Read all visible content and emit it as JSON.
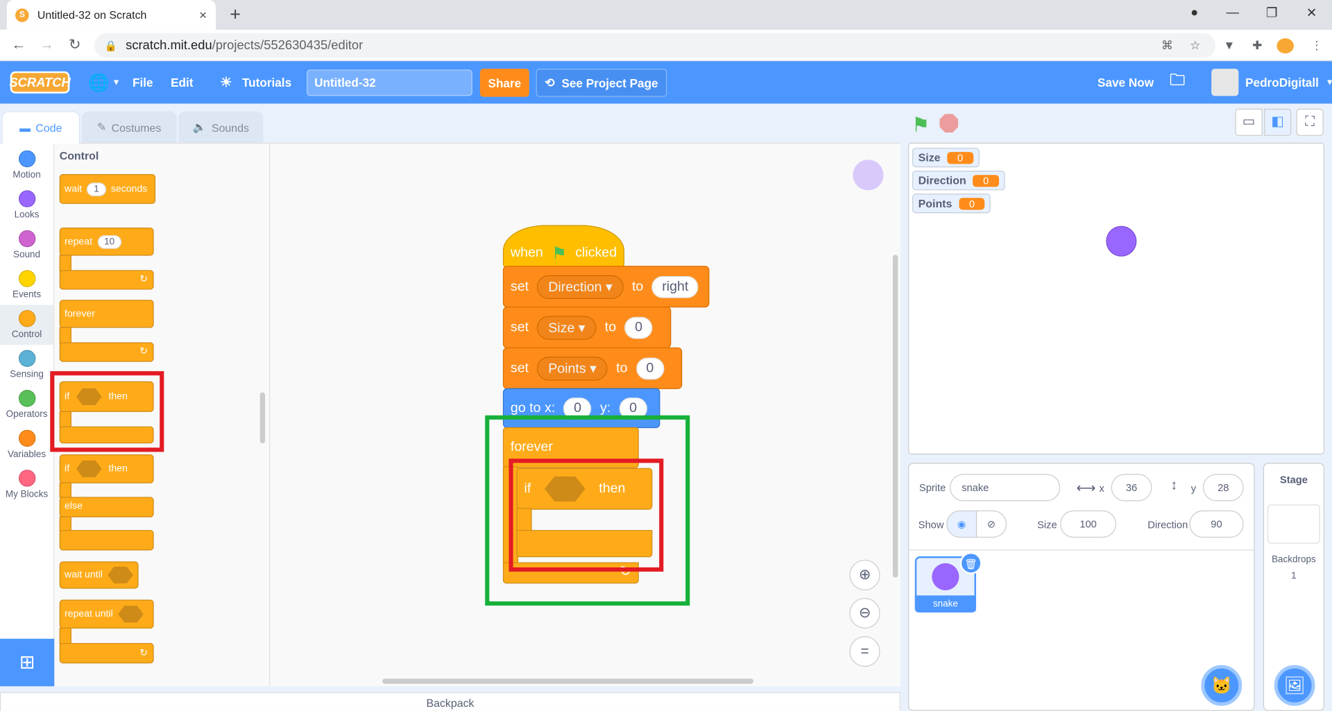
{
  "browser": {
    "tab_title": "Untitled-32 on Scratch",
    "url_domain": "scratch.mit.edu",
    "url_path": "/projects/552630435/editor",
    "new_tab": "+",
    "close": "✕"
  },
  "menubar": {
    "logo": "SCRATCH",
    "file": "File",
    "edit": "Edit",
    "tutorials": "Tutorials",
    "project_title": "Untitled-32",
    "share": "Share",
    "see_project": "See Project Page",
    "save_now": "Save Now",
    "username": "PedroDigitall"
  },
  "editor_tabs": [
    "Code",
    "Costumes",
    "Sounds"
  ],
  "categories": [
    {
      "label": "Motion",
      "color": "#4c97ff"
    },
    {
      "label": "Looks",
      "color": "#9966ff"
    },
    {
      "label": "Sound",
      "color": "#cf63cf"
    },
    {
      "label": "Events",
      "color": "#ffd500"
    },
    {
      "label": "Control",
      "color": "#ffab19"
    },
    {
      "label": "Sensing",
      "color": "#5cb1d6"
    },
    {
      "label": "Operators",
      "color": "#59c059"
    },
    {
      "label": "Variables",
      "color": "#ff8c1a"
    },
    {
      "label": "My Blocks",
      "color": "#ff6680"
    }
  ],
  "palette": {
    "title": "Control",
    "wait": "wait",
    "wait_val": "1",
    "seconds": "seconds",
    "repeat": "repeat",
    "repeat_val": "10",
    "forever": "forever",
    "if": "if",
    "then": "then",
    "if2": "if",
    "then2": "then",
    "else": "else",
    "wait_until": "wait until",
    "repeat_until": "repeat until"
  },
  "script": {
    "when": "when",
    "clicked": "clicked",
    "set": "set",
    "to": "to",
    "var1": "Direction",
    "val1": "right",
    "var2": "Size",
    "val2": "0",
    "var3": "Points",
    "val3": "0",
    "goto_x": "go to x:",
    "x_val": "0",
    "goto_y": "y:",
    "y_val": "0",
    "forever": "forever",
    "if": "if",
    "then": "then"
  },
  "monitors": [
    {
      "name": "Size",
      "value": "0"
    },
    {
      "name": "Direction",
      "value": "0"
    },
    {
      "name": "Points",
      "value": "0"
    }
  ],
  "sprite_info": {
    "sprite_label": "Sprite",
    "sprite_name": "snake",
    "x_label": "x",
    "x": "36",
    "y_label": "y",
    "y": "28",
    "show_label": "Show",
    "size_label": "Size",
    "size": "100",
    "direction_label": "Direction",
    "direction": "90"
  },
  "sprite_tile": {
    "name": "snake"
  },
  "stage_pane": {
    "title": "Stage",
    "backdrops_label": "Backdrops",
    "backdrops_count": "1"
  },
  "backpack": "Backpack",
  "colors": {
    "scratch_blue": "#4c97ff",
    "highlight_red": "#e31b23",
    "highlight_green": "#17b13a"
  }
}
